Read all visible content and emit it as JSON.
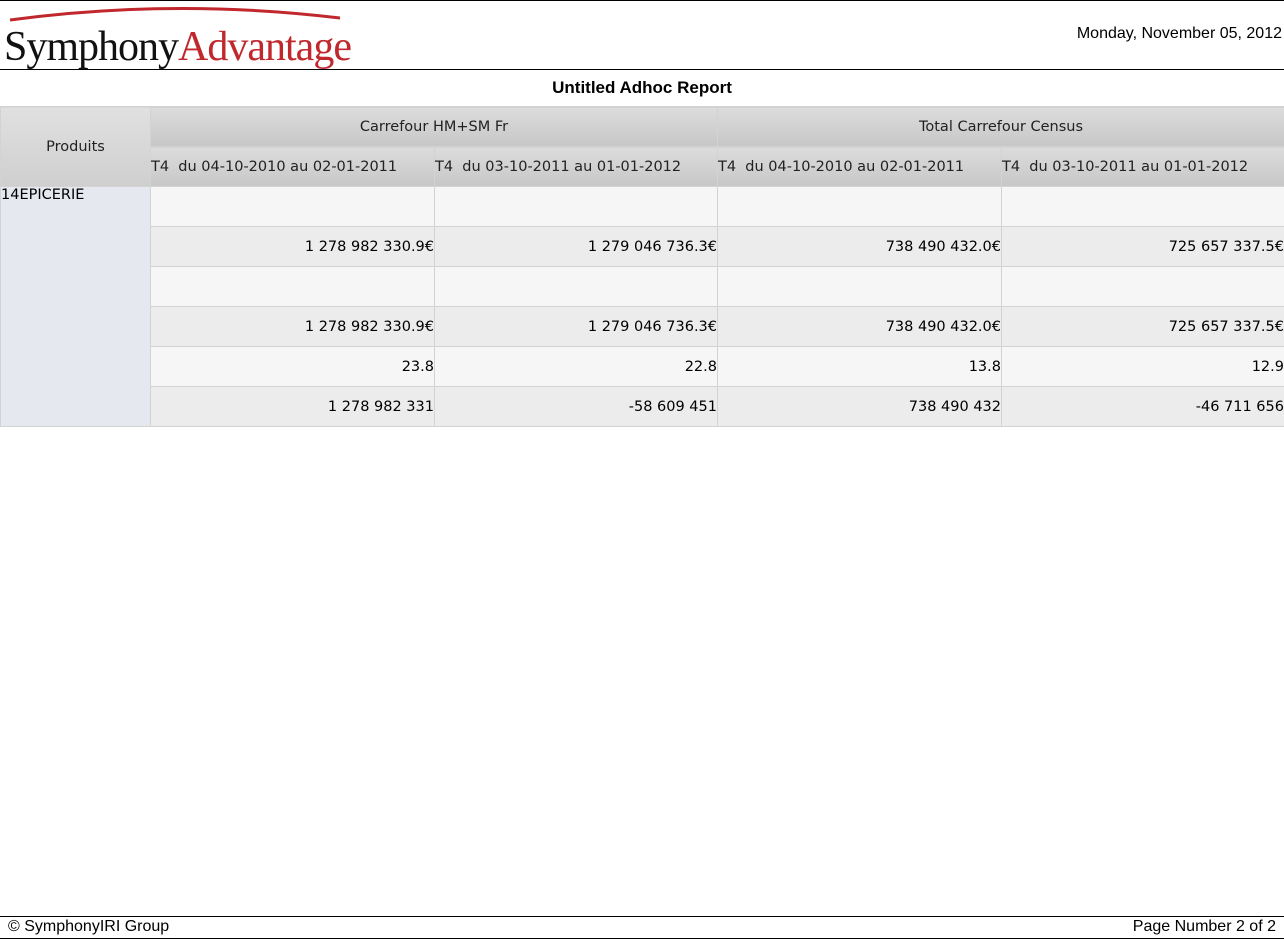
{
  "header": {
    "logo_part1": "Symphony",
    "logo_part2": "Advantage",
    "date": "Monday, November 05, 2012"
  },
  "report": {
    "title": "Untitled Adhoc Report"
  },
  "table": {
    "corner_label": "Produits",
    "groups": [
      "Carrefour HM+SM Fr",
      "Total Carrefour Census"
    ],
    "periods": [
      "T4  du 04-10-2010 au 02-01-2011",
      "T4  du 03-10-2011 au 01-01-2012",
      "T4  du 04-10-2010 au 02-01-2011",
      "T4  du 03-10-2011 au 01-01-2012"
    ],
    "row_label": "14EPICERIE",
    "rows": [
      [
        "",
        "",
        "",
        ""
      ],
      [
        "1 278 982 330.9€",
        "1 279 046 736.3€",
        "738 490 432.0€",
        "725 657 337.5€"
      ],
      [
        "",
        "",
        "",
        ""
      ],
      [
        "1 278 982 330.9€",
        "1 279 046 736.3€",
        "738 490 432.0€",
        "725 657 337.5€"
      ],
      [
        "23.8",
        "22.8",
        "13.8",
        "12.9"
      ],
      [
        "1 278 982 331",
        "-58 609 451",
        "738 490 432",
        "-46 711 656"
      ]
    ]
  },
  "footer": {
    "copyright": "© SymphonyIRI Group",
    "page_number": "Page Number 2 of 2"
  },
  "colors": {
    "brand_red": "#c0282d",
    "header_gray": "#cfcfcf",
    "row_label_bg": "#e5e9ef"
  }
}
